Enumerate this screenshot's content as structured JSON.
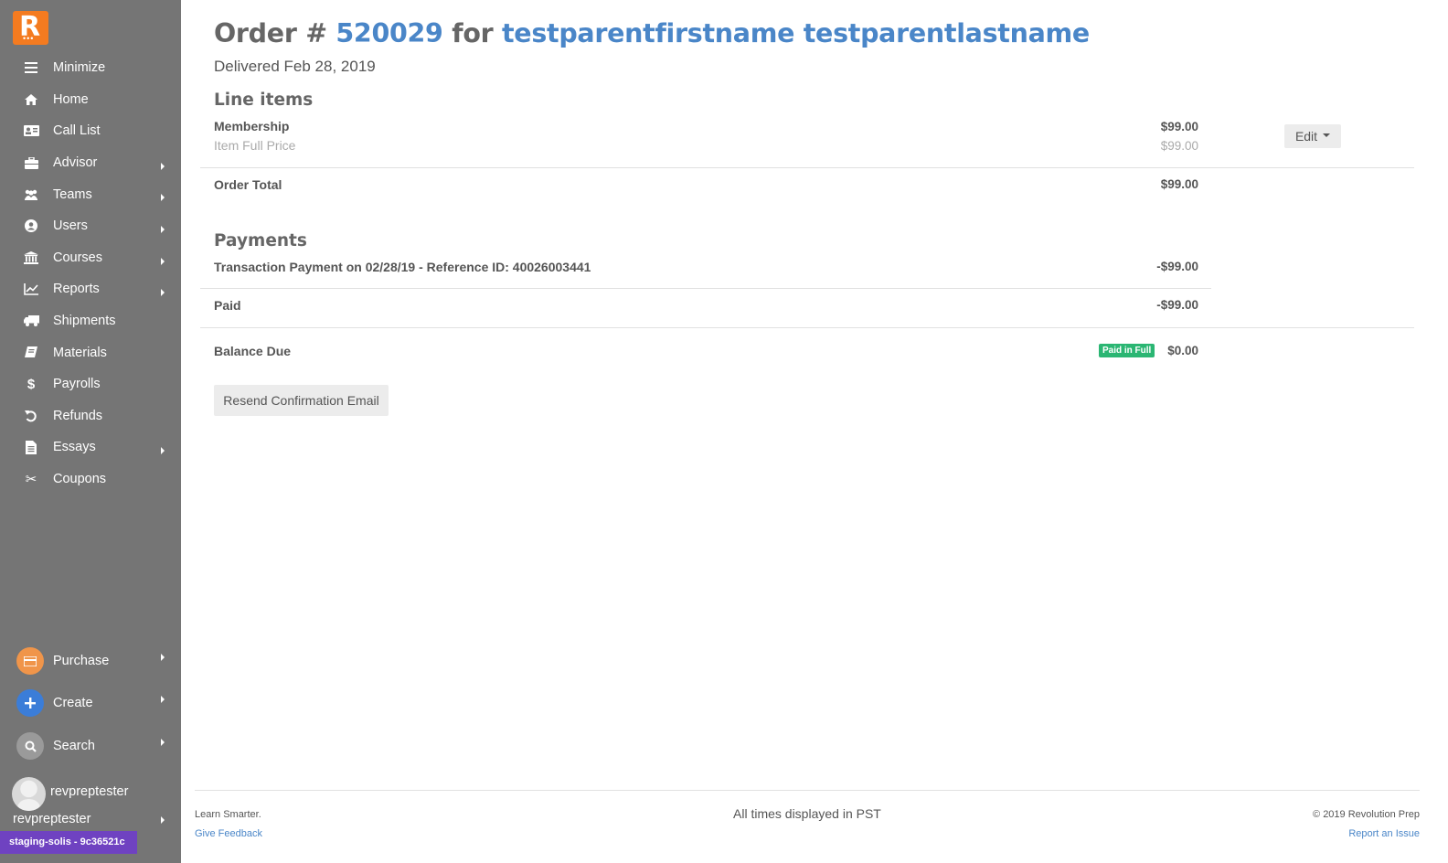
{
  "sidebar": {
    "logo_letter": "R",
    "items": [
      {
        "label": "Minimize",
        "icon": "bars-icon",
        "has_submenu": false
      },
      {
        "label": "Home",
        "icon": "home-icon",
        "has_submenu": false
      },
      {
        "label": "Call List",
        "icon": "address-card-icon",
        "has_submenu": false
      },
      {
        "label": "Advisor",
        "icon": "briefcase-icon",
        "has_submenu": true
      },
      {
        "label": "Teams",
        "icon": "users-icon",
        "has_submenu": true
      },
      {
        "label": "Users",
        "icon": "user-circle-icon",
        "has_submenu": true
      },
      {
        "label": "Courses",
        "icon": "institution-icon",
        "has_submenu": true
      },
      {
        "label": "Reports",
        "icon": "line-chart-icon",
        "has_submenu": true
      },
      {
        "label": "Shipments",
        "icon": "truck-icon",
        "has_submenu": false
      },
      {
        "label": "Materials",
        "icon": "book-icon",
        "has_submenu": false
      },
      {
        "label": "Payrolls",
        "icon": "dollar-icon",
        "has_submenu": false
      },
      {
        "label": "Refunds",
        "icon": "undo-icon",
        "has_submenu": false
      },
      {
        "label": "Essays",
        "icon": "file-text-icon",
        "has_submenu": true
      },
      {
        "label": "Coupons",
        "icon": "scissors-icon",
        "has_submenu": false
      }
    ],
    "bottom": {
      "purchase": {
        "label": "Purchase",
        "color": "#f0954a"
      },
      "create": {
        "label": "Create",
        "color": "#3b7dd8"
      },
      "search": {
        "label": "Search",
        "color": "#9a9a9a"
      }
    },
    "user": {
      "name": "revpreptester",
      "menu_label": "revpreptester"
    },
    "env_badge": "staging-solis - 9c36521c"
  },
  "order": {
    "title_prefix": "Order #",
    "order_number": "520029",
    "title_for": "for",
    "customer_name": "testparentfirstname testparentlastname",
    "delivered": "Delivered Feb 28, 2019"
  },
  "line_items": {
    "heading": "Line items",
    "items": [
      {
        "name": "Membership",
        "sub": "Item Full Price",
        "amount": "$99.00",
        "sub_amount": "$99.00"
      }
    ],
    "edit_label": "Edit",
    "total_label": "Order Total",
    "total_amount": "$99.00"
  },
  "payments": {
    "heading": "Payments",
    "transaction_label": "Transaction Payment on 02/28/19 - Reference ID: 40026003441",
    "transaction_amount": "-$99.00",
    "paid_label": "Paid",
    "paid_amount": "-$99.00",
    "balance_label": "Balance Due",
    "balance_badge": "Paid in Full",
    "balance_amount": "$0.00"
  },
  "actions": {
    "resend_label": "Resend Confirmation Email"
  },
  "footer": {
    "tagline": "Learn Smarter.",
    "feedback": "Give Feedback",
    "timezone": "All times displayed in PST",
    "copyright": "© 2019 Revolution Prep",
    "report": "Report an Issue"
  },
  "colors": {
    "sidebar_bg": "#757575",
    "accent_orange": "#f47b20",
    "link_blue": "#4a86c8",
    "badge_green": "#2bb673",
    "env_purple": "#6f42c1"
  }
}
